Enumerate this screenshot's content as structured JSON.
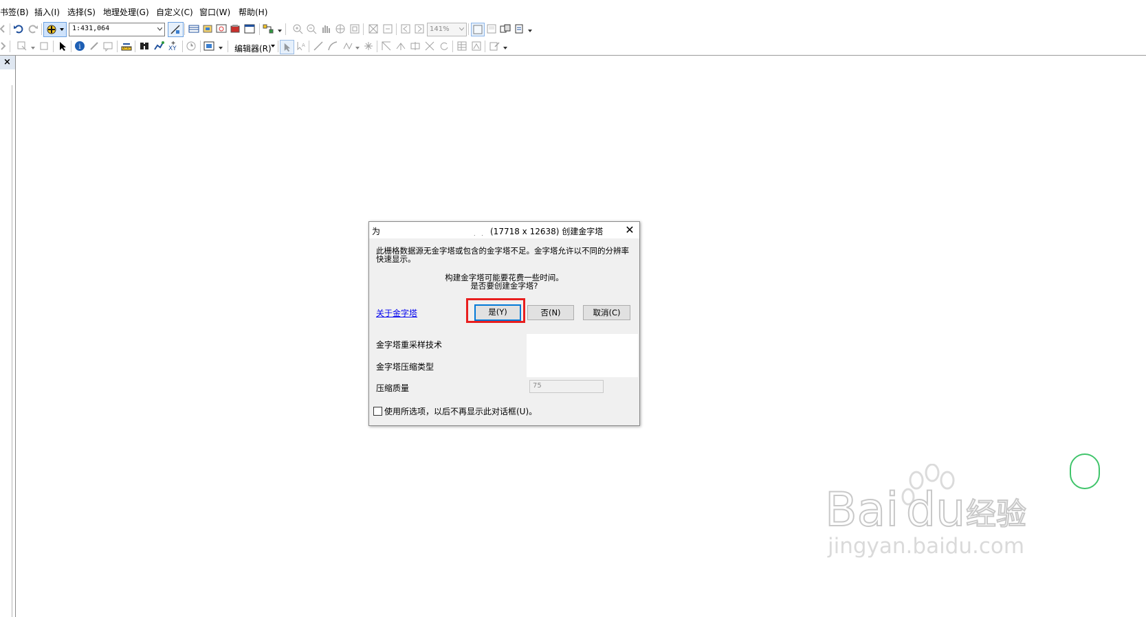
{
  "menubar": {
    "items": [
      "书签(B)",
      "插入(I)",
      "选择(S)",
      "地理处理(G)",
      "自定义(C)",
      "窗口(W)",
      "帮助(H)"
    ]
  },
  "toolbar": {
    "scale": "1:431,064",
    "zoom": "141%",
    "editor_label": "编辑器(R)"
  },
  "left_panel": {
    "close_label": "×"
  },
  "dialog": {
    "title_prefix": "为",
    "title_obscured": ". .",
    "title_suffix": "(17718 x 12638) 创建金字塔",
    "close_label": "✕",
    "message_line1": "此栅格数据源无金字塔或包含的金字塔不足。金字塔允许以不同的分辨率",
    "message_line2": "快速显示。",
    "question_line1": "构建金字塔可能要花费一些时间。",
    "question_line2": "是否要创建金字塔?",
    "about_link": "关于金字塔",
    "yes_button": "是(Y)",
    "no_button": "否(N)",
    "cancel_button": "取消(C)",
    "resampling_label": "金字塔重采样技术",
    "compression_type_label": "金字塔压缩类型",
    "quality_label": "压缩质量",
    "quality_value": "75",
    "checkbox_label": "使用所选项，以后不再显示此对话框(U)。",
    "highlight_color": "#e81e1e",
    "focus_color": "#0078d7"
  },
  "watermark": {
    "brand": "Bai",
    "brand2": "du",
    "suffix": "经验",
    "url": "jingyan.baidu.com"
  }
}
